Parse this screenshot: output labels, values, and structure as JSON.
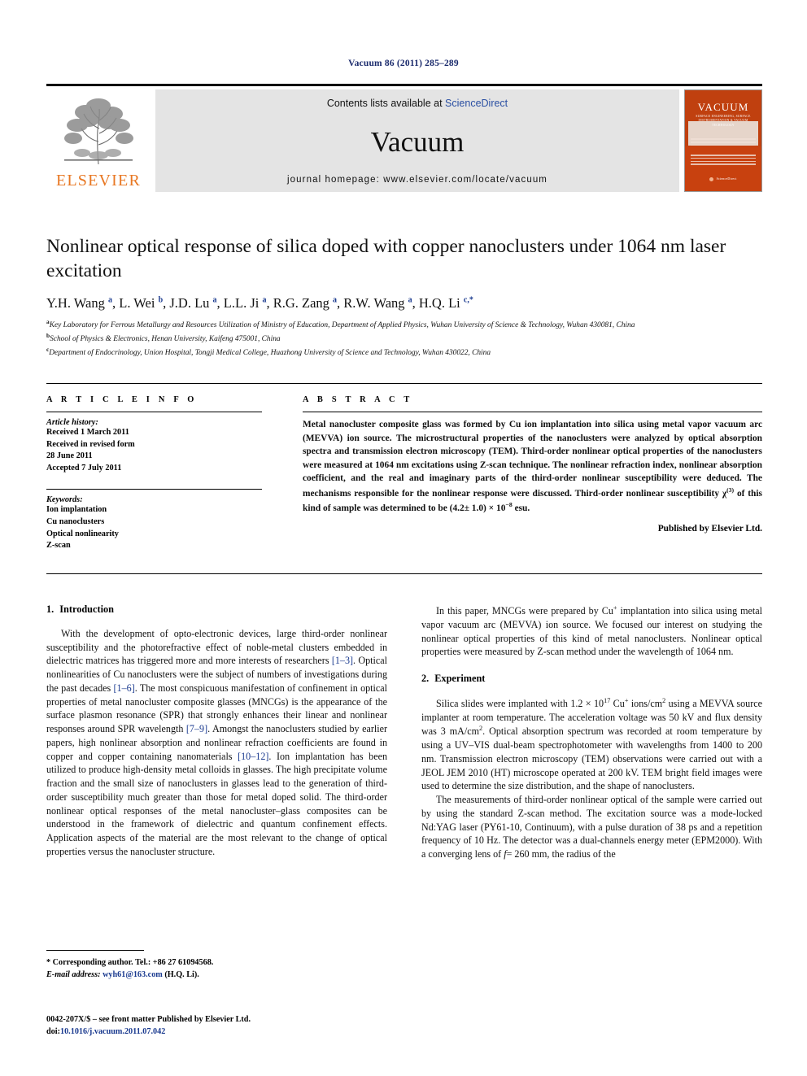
{
  "running_head": "Vacuum 86 (2011) 285–289",
  "masthead": {
    "contents_text": "Contents lists available at",
    "sciencedirect": "ScienceDirect",
    "journal_name": "Vacuum",
    "homepage": "journal homepage: www.elsevier.com/locate/vacuum",
    "publisher_logo_text": "ELSEVIER",
    "cover": {
      "title": "VACUUM",
      "subtitle": "SURFACE ENGINEERING, SURFACE INSTRUMENTATION & VACUUM TECHNOLOGY",
      "footer": "Available online at",
      "footer_brand": "ScienceDirect"
    },
    "accent_orange": "#E87722",
    "link_blue": "#2a4fa2",
    "band_gray": "#e4e4e4"
  },
  "article": {
    "title": "Nonlinear optical response of silica doped with copper nanoclusters under 1064 nm laser excitation",
    "authors_html": "Y.H. Wang <sup>a</sup>, L. Wei <sup>b</sup>, J.D. Lu <sup>a</sup>, L.L. Ji <sup>a</sup>, R.G. Zang <sup>a</sup>, R.W. Wang <sup>a</sup>, H.Q. Li <sup>c,*</sup>",
    "affiliations": [
      "Key Laboratory for Ferrous Metallurgy and Resources Utilization of Ministry of Education, Department of Applied Physics, Wuhan University of Science & Technology, Wuhan 430081, China",
      "School of Physics & Electronics, Henan University, Kaifeng 475001, China",
      "Department of Endocrinology, Union Hospital, Tongji Medical College, Huazhong University of Science and Technology, Wuhan 430022, China"
    ],
    "affiliation_marks": [
      "a",
      "b",
      "c"
    ]
  },
  "article_info": {
    "heading": "A R T I C L E  I N F O",
    "history_label": "Article history:",
    "history": [
      "Received 1 March 2011",
      "Received in revised form",
      "28 June 2011",
      "Accepted 7 July 2011"
    ],
    "keywords_label": "Keywords:",
    "keywords": [
      "Ion implantation",
      "Cu nanoclusters",
      "Optical nonlinearity",
      "Z-scan"
    ]
  },
  "abstract": {
    "heading": "A B S T R A C T",
    "text_html": "Metal nanocluster composite glass was formed by Cu ion implantation into silica using metal vapor vacuum arc (MEVVA) ion source. The microstructural properties of the nanoclusters were analyzed by optical absorption spectra and transmission electron microscopy (TEM). Third-order nonlinear optical properties of the nanoclusters were measured at 1064 nm excitations using Z-scan technique. The nonlinear refraction index, nonlinear absorption coefficient, and the real and imaginary parts of the third-order nonlinear susceptibility were deduced. The mechanisms responsible for the nonlinear response were discussed. Third-order nonlinear susceptibility χ<sup class=\"sm\">(3)</sup> of this kind of sample was determined to be (4.2± 1.0) × 10<sup class=\"sm\">−8</sup> esu.",
    "published_by": "Published by Elsevier Ltd."
  },
  "sections": {
    "introduction": {
      "number": "1.",
      "title": "Introduction",
      "paragraphs_html": [
        "With the development of opto-electronic devices, large third-order nonlinear susceptibility and the photorefractive effect of noble-metal clusters embedded in dielectric matrices has triggered more and more interests of researchers <span class=\"ref\">[1–3]</span>. Optical nonlinearities of Cu nanoclusters were the subject of numbers of investigations during the past decades <span class=\"ref\">[1–6]</span>. The most conspicuous manifestation of confinement in optical properties of metal nanocluster composite glasses (MNCGs) is the appearance of the surface plasmon resonance (SPR) that strongly enhances their linear and nonlinear responses around SPR wavelength <span class=\"ref\">[7–9]</span>. Amongst the nanoclusters studied by earlier papers, high nonlinear absorption and nonlinear refraction coefficients are found in copper and copper containing nanomaterials <span class=\"ref\">[10–12]</span>. Ion implantation has been utilized to produce high-density metal colloids in glasses. The high precipitate volume fraction and the small size of nanoclusters in glasses lead to the generation of third-order susceptibility much greater than those for metal doped solid. The third-order nonlinear optical responses of the metal nanocluster–glass composites can be understood in the framework of dielectric and quantum confinement effects. Application aspects of the material are the most relevant to the change of optical properties versus the nanocluster structure.",
        "In this paper, MNCGs were prepared by Cu<sup class=\"sm\">+</sup> implantation into silica using metal vapor vacuum arc (MEVVA) ion source. We focused our interest on studying the nonlinear optical properties of this kind of metal nanoclusters. Nonlinear optical properties were measured by Z-scan method under the wavelength of 1064 nm."
      ]
    },
    "experiment": {
      "number": "2.",
      "title": "Experiment",
      "paragraphs_html": [
        "Silica slides were implanted with 1.2 × 10<sup class=\"sm\">17</sup> Cu<sup class=\"sm\">+</sup> ions/cm<sup class=\"sm\">2</sup> using a MEVVA source implanter at room temperature. The acceleration voltage was 50 kV and flux density was 3 mA/cm<sup class=\"sm\">2</sup>. Optical absorption spectrum was recorded at room temperature by using a UV–VIS dual-beam spectrophotometer with wavelengths from 1400 to 200 nm. Transmission electron microscopy (TEM) observations were carried out with a JEOL JEM 2010 (HT) microscope operated at 200 kV. TEM bright field images were used to determine the size distribution, and the shape of nanoclusters.",
        "The measurements of third-order nonlinear optical of the sample were carried out by using the standard Z-scan method. The excitation source was a mode-locked Nd:YAG laser (PY61-10, Continuum), with a pulse duration of 38 ps and a repetition frequency of 10 Hz. The detector was a dual-channels energy meter (EPM2000). With a converging lens of <i>f</i>= 260 mm, the radius of the"
      ]
    }
  },
  "footnotes": {
    "corresponding_html": "* Corresponding author. Tel.: +86 27 61094568.",
    "email_label": "E-mail address:",
    "email": "wyh61@163.com",
    "email_owner": "(H.Q. Li)."
  },
  "imprint": {
    "line1": "0042-207X/$ – see front matter Published by Elsevier Ltd.",
    "doi_label": "doi:",
    "doi": "10.1016/j.vacuum.2011.07.042"
  }
}
